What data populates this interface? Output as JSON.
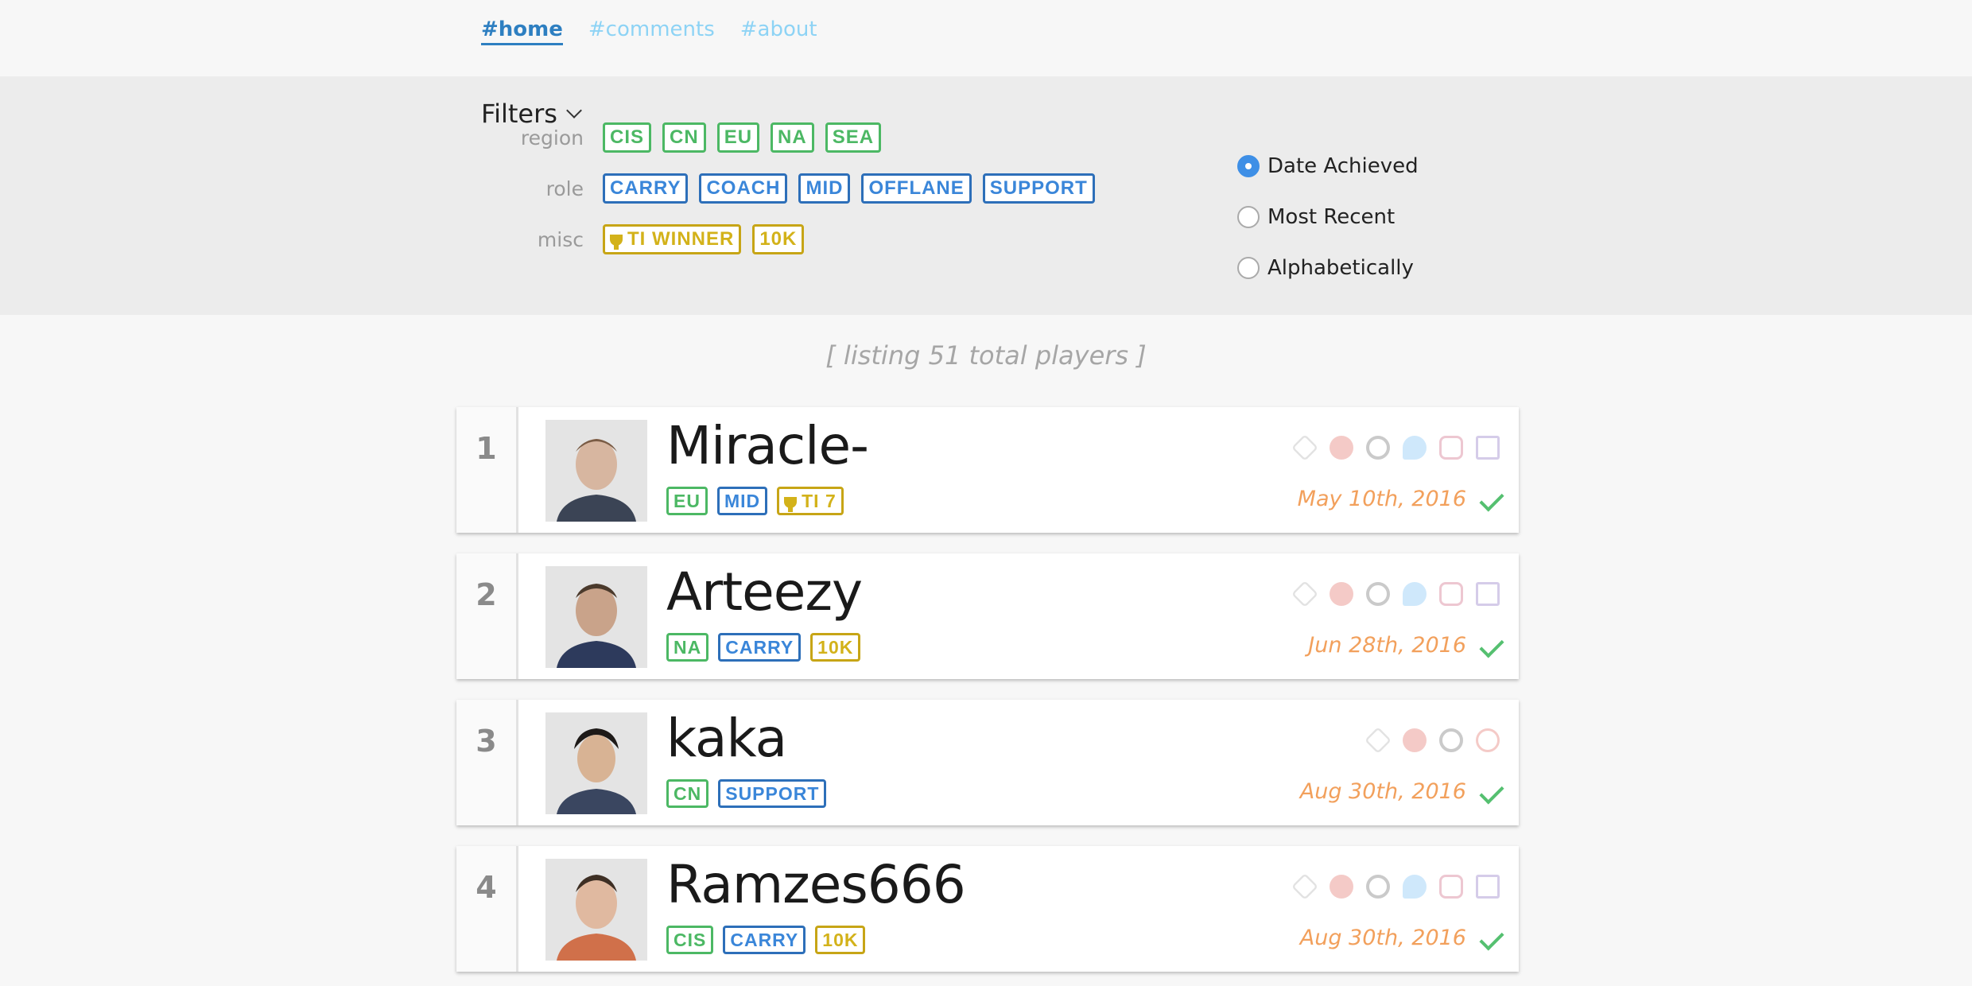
{
  "nav": [
    {
      "label": "#home",
      "active": true
    },
    {
      "label": "#comments",
      "active": false
    },
    {
      "label": "#about",
      "active": false
    }
  ],
  "filters": {
    "title": "Filters",
    "region_label": "region",
    "role_label": "role",
    "misc_label": "misc",
    "regions": [
      "CIS",
      "CN",
      "EU",
      "NA",
      "SEA"
    ],
    "roles": [
      "CARRY",
      "COACH",
      "MID",
      "OFFLANE",
      "SUPPORT"
    ],
    "misc": [
      "TI WINNER",
      "10K"
    ]
  },
  "sort": {
    "options": [
      "Date Achieved",
      "Most Recent",
      "Alphabetically"
    ],
    "selected": "Date Achieved"
  },
  "listing_text": "[ listing 51 total players ]",
  "players": [
    {
      "rank": "1",
      "name": "Miracle-",
      "tags": [
        "EU",
        "MID",
        "TI 7"
      ],
      "date": "May 10th, 2016",
      "socials": [
        "dota-icon",
        "dotabuff-icon",
        "opendota-icon",
        "twitter-icon",
        "instagram-icon",
        "twitch-icon"
      ]
    },
    {
      "rank": "2",
      "name": "Arteezy",
      "tags": [
        "NA",
        "CARRY",
        "10K"
      ],
      "date": "Jun 28th, 2016",
      "socials": [
        "dota-icon",
        "dotabuff-icon",
        "opendota-icon",
        "twitter-icon",
        "instagram-icon",
        "twitch-icon"
      ]
    },
    {
      "rank": "3",
      "name": "kaka",
      "tags": [
        "CN",
        "SUPPORT"
      ],
      "date": "Aug 30th, 2016",
      "socials": [
        "dota-icon",
        "dotabuff-icon",
        "opendota-icon",
        "weibo-icon"
      ]
    },
    {
      "rank": "4",
      "name": "Ramzes666",
      "tags": [
        "CIS",
        "CARRY",
        "10K"
      ],
      "date": "Aug 30th, 2016",
      "socials": [
        "dota-icon",
        "dotabuff-icon",
        "opendota-icon",
        "twitter-icon",
        "instagram-icon",
        "twitch-icon"
      ]
    }
  ],
  "colors": {
    "region": "#4cb864",
    "role": "#3a86d9",
    "misc": "#d3b21a",
    "date": "#f2a05c",
    "check": "#55c070",
    "radio_selected": "#3e8fe6"
  }
}
